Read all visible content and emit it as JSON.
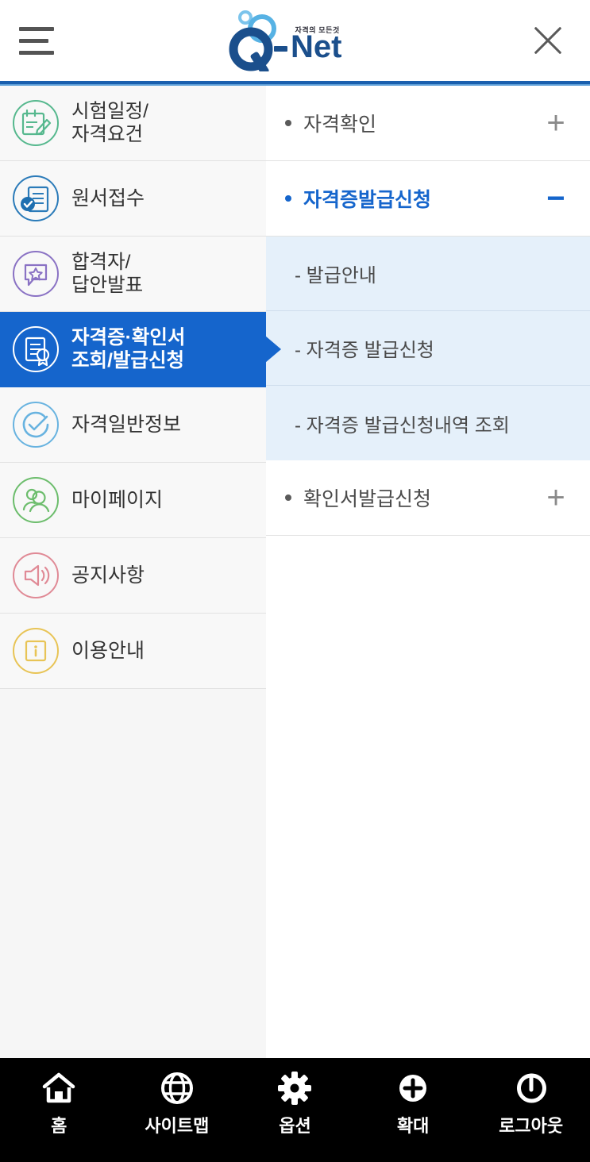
{
  "header": {
    "menu_icon": "hamburger-icon",
    "close_icon": "close-icon",
    "logo": {
      "tagline": "자격의 모든것",
      "mark": "Q",
      "name": "- Net",
      "mark_color": "#1b4f8c",
      "bubble_color": "#63b8e8"
    }
  },
  "sidebar": {
    "items": [
      {
        "label": "시험일정/\n자격요건",
        "icon": "calendar-pencil-icon",
        "color": "#56b88e",
        "active": false
      },
      {
        "label": "원서접수",
        "icon": "document-check-icon",
        "color": "#2b7bb9",
        "active": false
      },
      {
        "label": "합격자/\n답안발표",
        "icon": "speech-bubble-star-icon",
        "color": "#8a72c4",
        "active": false
      },
      {
        "label": "자격증·확인서\n조회/발급신청",
        "icon": "certificate-award-icon",
        "color": "#ffffff",
        "active": true
      },
      {
        "label": "자격일반정보",
        "icon": "check-circle-icon",
        "color": "#68b3e0",
        "active": false
      },
      {
        "label": "마이페이지",
        "icon": "user-people-icon",
        "color": "#6cbd6c",
        "active": false
      },
      {
        "label": "공지사항",
        "icon": "megaphone-icon",
        "color": "#e08a96",
        "active": false
      },
      {
        "label": "이용안내",
        "icon": "info-icon",
        "color": "#e8c456",
        "active": false
      }
    ],
    "active_bg": "#1565cc"
  },
  "panel": {
    "rows": [
      {
        "label": "자격확인",
        "sign": "+",
        "expanded": false
      },
      {
        "label": "자격증발급신청",
        "sign": "−",
        "expanded": true
      },
      {
        "label": "확인서발급신청",
        "sign": "+",
        "expanded": false
      }
    ],
    "sub_items": [
      {
        "label": "- 발급안내"
      },
      {
        "label": "- 자격증 발급신청"
      },
      {
        "label": "- 자격증 발급신청내역 조회"
      }
    ],
    "accent_color": "#1565cc",
    "sub_bg": "#e5f0fa"
  },
  "bottom_nav": {
    "items": [
      {
        "label": "홈",
        "icon": "home-icon"
      },
      {
        "label": "사이트맵",
        "icon": "globe-icon"
      },
      {
        "label": "옵션",
        "icon": "gear-icon"
      },
      {
        "label": "확대",
        "icon": "plus-circle-icon"
      },
      {
        "label": "로그아웃",
        "icon": "power-icon"
      }
    ],
    "bg": "#000000"
  }
}
